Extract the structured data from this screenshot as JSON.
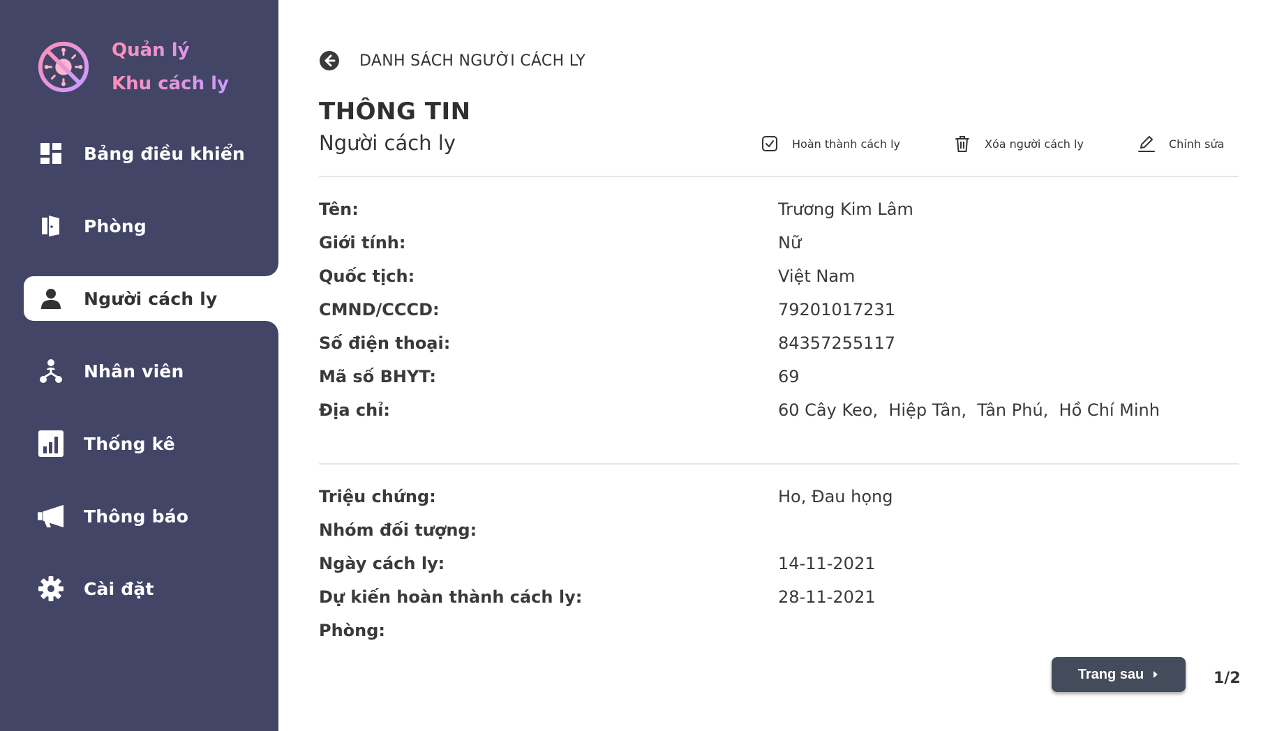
{
  "brand": {
    "line1": "Quản lý",
    "line2": "Khu cách ly"
  },
  "sidebar": {
    "items": [
      {
        "label": "Bảng điều khiển",
        "icon": "dashboard-icon"
      },
      {
        "label": "Phòng",
        "icon": "door-icon"
      },
      {
        "label": "Người cách ly",
        "icon": "person-icon",
        "active": true
      },
      {
        "label": "Nhân viên",
        "icon": "org-chart-icon"
      },
      {
        "label": "Thống kê",
        "icon": "bar-chart-icon"
      },
      {
        "label": "Thông báo",
        "icon": "megaphone-icon"
      },
      {
        "label": "Cài đặt",
        "icon": "gear-icon"
      }
    ]
  },
  "header": {
    "back_label": "DANH SÁCH NGƯỜI CÁCH LY",
    "title": "THÔNG TIN",
    "subtitle": "Người cách ly"
  },
  "actions": {
    "complete_label": "Hoàn thành cách ly",
    "delete_label": "Xóa người cách ly",
    "edit_label": "Chỉnh sửa"
  },
  "personal_info": [
    {
      "label": "Tên:",
      "value": "Trương Kim Lâm"
    },
    {
      "label": "Giới tính:",
      "value": "Nữ"
    },
    {
      "label": "Quốc tịch:",
      "value": "Việt Nam"
    },
    {
      "label": "CMND/CCCD:",
      "value": "79201017231"
    },
    {
      "label": "Số điện thoại:",
      "value": "84357255117"
    },
    {
      "label": "Mã số BHYT:",
      "value": "69"
    },
    {
      "label": "Địa chỉ:",
      "value": "60 Cây Keo,  Hiệp Tân,  Tân Phú,  Hồ Chí Minh"
    }
  ],
  "quarantine_info": [
    {
      "label": "Triệu chứng:",
      "value": "Ho, Đau họng"
    },
    {
      "label": "Nhóm đối tượng:",
      "value": ""
    },
    {
      "label": "Ngày cách ly:",
      "value": "14-11-2021"
    },
    {
      "label": "Dự kiến hoàn thành cách ly:",
      "value": "28-11-2021"
    },
    {
      "label": "Phòng:",
      "value": ""
    }
  ],
  "pagination": {
    "next_label": "Trang sau",
    "page_indicator": "1/2"
  },
  "colors": {
    "sidebar_bg": "#434567",
    "brand_gradient_start": "#ff8fb8",
    "brand_gradient_end": "#c99cff",
    "button_bg": "#444b5a"
  }
}
